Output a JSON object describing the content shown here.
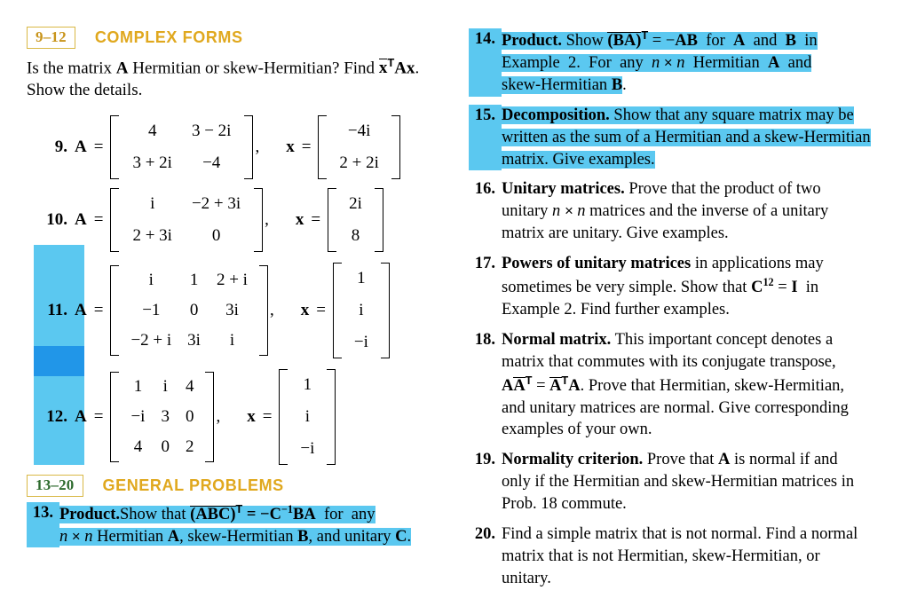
{
  "page": {
    "background": "#ffffff",
    "highlight_light": "#5bc8f0",
    "highlight_dark": "#2196e8",
    "accent_gold": "#e0a81e",
    "range_box_border": "#d9b845",
    "range_box_text": "#c8941a",
    "range_box_text_on_highlight": "#2e6b2e"
  },
  "left_column": {
    "section": {
      "range": "9–12",
      "title": "COMPLEX FORMS"
    },
    "intro": {
      "line1_a": "Is the matrix ",
      "line1_A": "A",
      "line1_b": " Hermitian or skew-Hermitian? Find ",
      "line1_x": "x",
      "line1_T": "T",
      "line1_Ax": "Ax",
      "line1_end": ".",
      "line2": "Show the details."
    },
    "problems": [
      {
        "number": "9.",
        "matrix_label": "A",
        "equals": "=",
        "matrix": [
          [
            "4",
            "3 − 2i"
          ],
          [
            "3 + 2i",
            "−4"
          ]
        ],
        "comma": ",",
        "vector_label": "x",
        "vector": [
          [
            "−4i"
          ],
          [
            "2 + 2i"
          ]
        ]
      },
      {
        "number": "10.",
        "matrix_label": "A",
        "equals": "=",
        "matrix": [
          [
            "i",
            "−2 + 3i"
          ],
          [
            "2 + 3i",
            "0"
          ]
        ],
        "comma": ",",
        "vector_label": "x",
        "vector": [
          [
            "2i"
          ],
          [
            "8"
          ]
        ]
      },
      {
        "number": "11.",
        "matrix_label": "A",
        "equals": "=",
        "matrix": [
          [
            "i",
            "1",
            "2 + i"
          ],
          [
            "−1",
            "0",
            "3i"
          ],
          [
            "−2 + i",
            "3i",
            "i"
          ]
        ],
        "comma": ",",
        "vector_label": "x",
        "vector": [
          [
            "1"
          ],
          [
            "i"
          ],
          [
            "−i"
          ]
        ]
      },
      {
        "number": "12.",
        "matrix_label": "A",
        "equals": "=",
        "matrix": [
          [
            "1",
            "i",
            "4"
          ],
          [
            "−i",
            "3",
            "0"
          ],
          [
            "4",
            "0",
            "2"
          ]
        ],
        "comma": ",",
        "vector_label": "x",
        "vector": [
          [
            "1"
          ],
          [
            "i"
          ],
          [
            "−i"
          ]
        ]
      }
    ],
    "section2": {
      "range": "13–20",
      "title": "GENERAL PROBLEMS"
    },
    "problem13": {
      "number": "13.",
      "lead": "Product.",
      "text_a": "Show  that  ",
      "overline": "(ABC)",
      "sup_T": "T",
      "text_b": " = −C",
      "sup_inv": "−1",
      "text_c": "BA  for  any",
      "line2_n": "n",
      "line2_times": "×",
      "line2_n2": "n",
      "line2_rest_a": " Hermitian ",
      "line2_A": "A",
      "line2_rest_b": ", skew-Hermitian ",
      "line2_B": "B",
      "line2_rest_c": ", and unitary ",
      "line2_C": "C",
      "line2_end": ".",
      "highlighted": true
    }
  },
  "right_column": {
    "problems": [
      {
        "number": "14.",
        "lead": "Product.",
        "highlighted": true,
        "line1_a": " Show  ",
        "line1_overline": "(BA)",
        "line1_sup": "T",
        "line1_b": " = −AB  for  A  and  B  in",
        "line2": "Example  2.  For  any  n × n  Hermitian  A  and",
        "line3_a": "skew-Hermitian ",
        "line3_B": "B",
        "line3_end": "."
      },
      {
        "number": "15.",
        "lead": "Decomposition.",
        "highlighted": true,
        "line1": " Show that any square matrix may be",
        "line2": "written as the sum of a Hermitian and a skew-Hermitian",
        "line3": "matrix. Give examples."
      },
      {
        "number": "16.",
        "lead": "Unitary matrices.",
        "highlighted": false,
        "line1": " Prove  that  the  product  of  two",
        "line2_a": "unitary  ",
        "line2_n": "n × n",
        "line2_b": "  matrices  and  the  inverse  of  a  unitary",
        "line3": "matrix are unitary. Give examples."
      },
      {
        "number": "17.",
        "lead": "Powers of unitary matrices",
        "highlighted": false,
        "line1": " in  applications  may",
        "line2_a": "sometimes  be  very  simple.  Show  that  ",
        "line2_C": "C",
        "line2_sup": "12",
        "line2_b": " = I  in",
        "line3": "Example 2. Find further examples."
      },
      {
        "number": "18.",
        "lead": "Normal matrix.",
        "highlighted": false,
        "line1": " This  important  concept  denotes  a",
        "line2": "matrix  that  commutes  with  its  conjugate  transpose,",
        "line3_A": "A",
        "line3_Abar": "A",
        "line3_supT": "T",
        "line3_eq": " = ",
        "line3_Abar2": "A",
        "line3_supT2": "T",
        "line3_A2": "A",
        "line3_rest": ". Prove that Hermitian, skew-Hermitian,",
        "line4": "and unitary matrices are normal. Give corresponding",
        "line5": "examples of your own."
      },
      {
        "number": "19.",
        "lead": "Normality criterion.",
        "highlighted": false,
        "line1_a": " Prove that ",
        "line1_A": "A",
        "line1_b": " is normal if and",
        "line2": "only if the Hermitian and skew-Hermitian matrices in",
        "line3": "Prob. 18 commute."
      },
      {
        "number": "20.",
        "lead": "",
        "highlighted": false,
        "line1": "Find a simple matrix that is not normal. Find a normal",
        "line2": "matrix  that  is  not  Hermitian,  skew-Hermitian,  or",
        "line3": "unitary."
      }
    ]
  }
}
